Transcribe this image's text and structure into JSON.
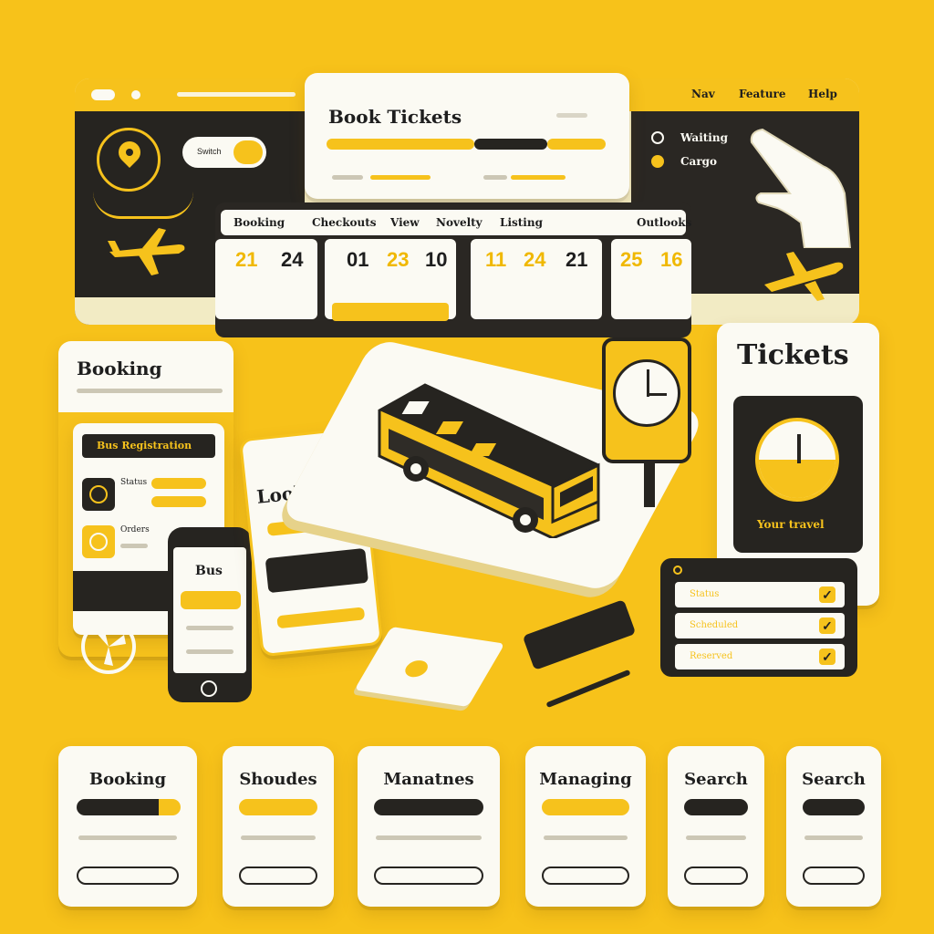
{
  "colors": {
    "background": "#f7c21a",
    "accent": "#f6c21c",
    "dark": "#262420",
    "card": "#fbfaf3"
  },
  "dashboard": {
    "top_menu": [
      "Nav",
      "Feature",
      "Help"
    ],
    "toggle_label": "Switch",
    "legend": [
      "Waiting",
      "Cargo"
    ]
  },
  "book_tickets": {
    "title": "Book Tickets"
  },
  "dates_panel": {
    "tabs": [
      "Booking",
      "Checkouts",
      "View",
      "Novelty",
      "Listing",
      "Outlooks"
    ],
    "dates": [
      [
        "21",
        "24"
      ],
      [
        "01",
        "23",
        "10"
      ],
      [
        "11",
        "24",
        "21"
      ],
      [
        "25",
        "16"
      ]
    ]
  },
  "booking_panel": {
    "title": "Booking",
    "section": "Bus Registration",
    "items": [
      "Status",
      "Orders"
    ]
  },
  "phone": {
    "title": "Bus"
  },
  "looking_card": {
    "title": "Looking"
  },
  "tickets_card": {
    "title": "Tickets",
    "caption": "Your travel"
  },
  "checklist": {
    "items": [
      "Status",
      "Scheduled",
      "Reserved"
    ]
  },
  "bottom_cards": [
    {
      "title": "Booking"
    },
    {
      "title": "Shoudes"
    },
    {
      "title": "Manatnes"
    },
    {
      "title": "Managing"
    },
    {
      "title": "Search"
    },
    {
      "title": "Search"
    }
  ]
}
